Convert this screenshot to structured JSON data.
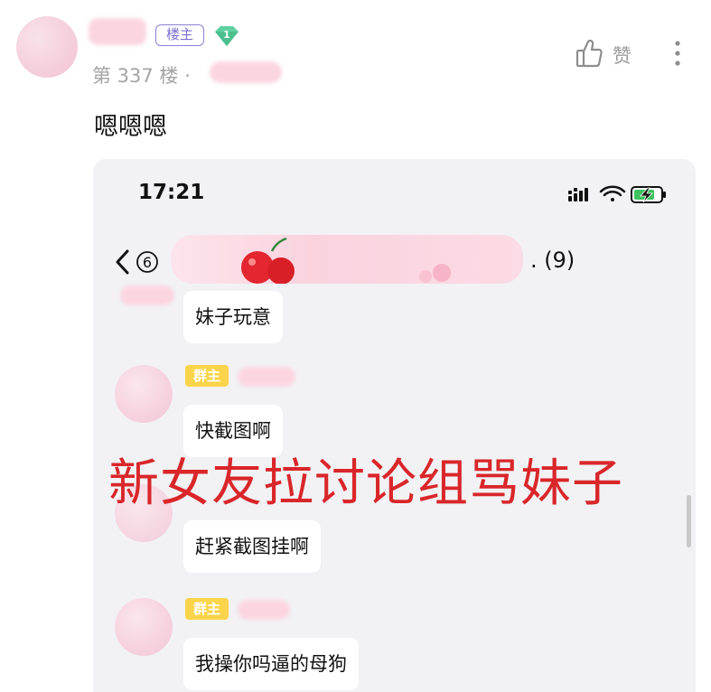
{
  "post": {
    "owner_tag": "楼主",
    "level": "1",
    "floor": "第 337 楼 ·",
    "like_label": "赞",
    "content": "嗯嗯嗯"
  },
  "screenshot": {
    "status_time": "17:21",
    "nav_back_count": "⑥",
    "group_member_count": ". (9)",
    "messages": [
      {
        "text": "妹子玩意"
      },
      {
        "role": "群主",
        "text": "快截图啊"
      },
      {
        "text": "赶紧截图挂啊"
      },
      {
        "role": "群主",
        "text": "我操你吗逼的母狗"
      }
    ]
  },
  "overlay_caption": "新女友拉讨论组骂妹子",
  "icons": {
    "like": "thumbs-up-icon",
    "more": "more-vertical-icon",
    "level": "diamond-level-icon",
    "back": "chevron-left-icon",
    "signal": "signal-icon",
    "wifi": "wifi-icon",
    "battery": "battery-charging-icon"
  },
  "colors": {
    "owner_tag_border": "#8a7fd6",
    "level_badge": "#5fd0a0",
    "role_tag": "#fbd44a",
    "caption": "#d9262a",
    "battery": "#3cc25e"
  }
}
